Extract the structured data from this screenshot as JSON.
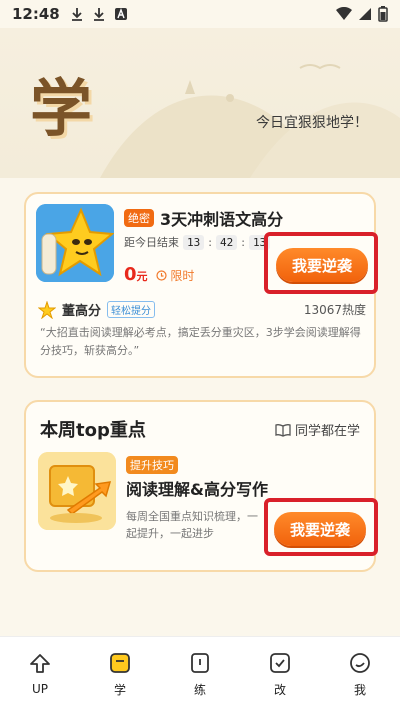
{
  "status_bar": {
    "time": "12:48"
  },
  "header": {
    "big_char": "学",
    "motto": "今日宜狠狠地学！"
  },
  "card1": {
    "tag": "绝密",
    "title": "3天冲刺语文高分",
    "countdown_label": "距今日结束",
    "countdown": [
      "13",
      "42",
      "13"
    ],
    "price": "0",
    "price_unit": "元",
    "limit_text": "限时",
    "button": "我要逆袭",
    "author": "董高分",
    "author_badge": "轻松提分",
    "heat": "13067热度",
    "quote": "“大招直击阅读理解必考点，搞定丢分重灾区，3步学会阅读理解得分技巧，斩获高分。”"
  },
  "card2": {
    "heading": "本周top重点",
    "right_text": "同学都在学",
    "tag": "提升技巧",
    "title": "阅读理解&高分写作",
    "desc": "每周全国重点知识梳理，一起提升，一起进步",
    "button": "我要逆袭"
  },
  "bottom_nav": [
    {
      "label": "UP",
      "icon": "up-arrow-icon"
    },
    {
      "label": "学",
      "icon": "book-icon"
    },
    {
      "label": "练",
      "icon": "practice-icon"
    },
    {
      "label": "改",
      "icon": "check-icon"
    },
    {
      "label": "我",
      "icon": "profile-icon"
    }
  ],
  "colors": {
    "accent": "#f1620c",
    "highlight_frame": "#d9202a",
    "card_border": "#f7d9a8",
    "background": "#fbf7ec"
  }
}
